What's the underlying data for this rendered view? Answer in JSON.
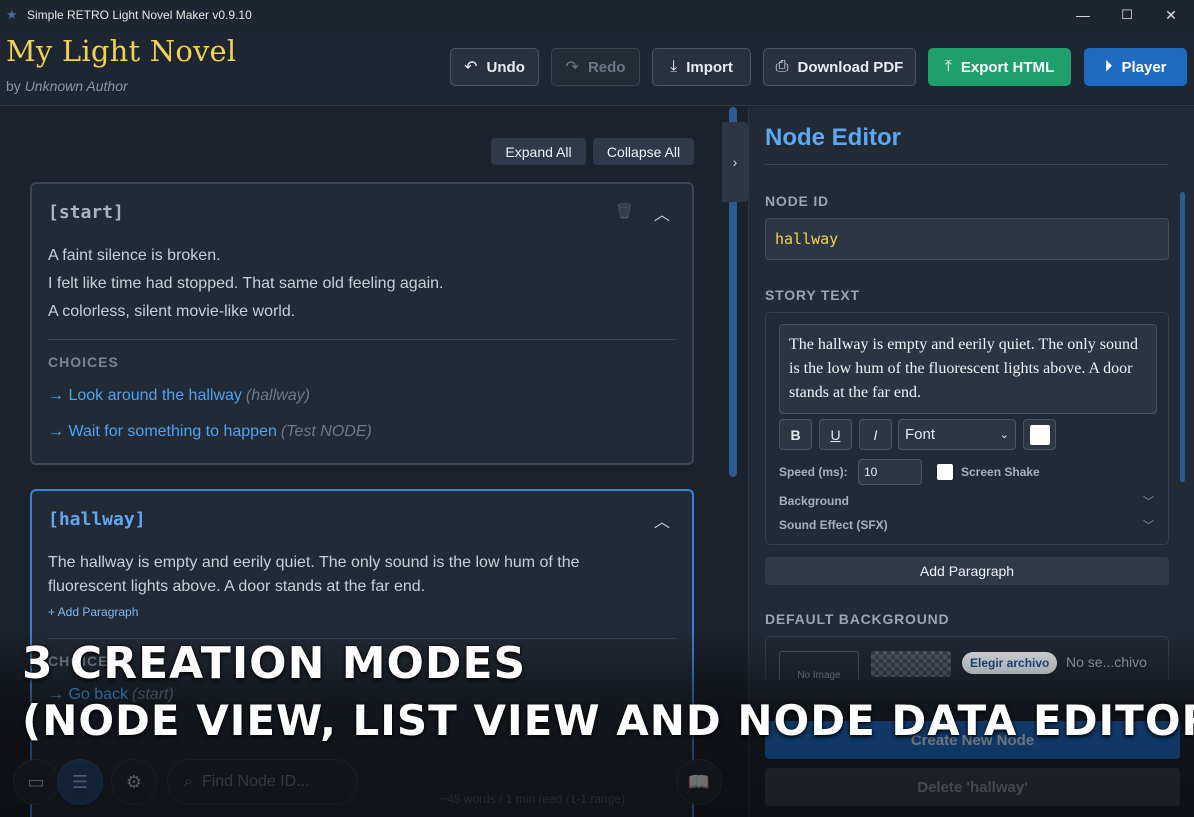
{
  "window": {
    "title": "Simple RETRO Light Novel Maker v0.9.10",
    "controls": [
      "—",
      "☐",
      "✕"
    ]
  },
  "header": {
    "app_title": "My Light Novel",
    "by": "by",
    "author": "Unknown Author",
    "buttons": {
      "undo": "Undo",
      "redo": "Redo",
      "import": "Import",
      "download_pdf": "Download PDF",
      "export_html": "Export HTML",
      "player": "Player"
    }
  },
  "list": {
    "expand_all": "Expand All",
    "collapse_all": "Collapse All",
    "cards": [
      {
        "id": "[start]",
        "lines": [
          "A faint silence is broken.",
          "I felt like time had stopped. That same old feeling again.",
          "A colorless, silent movie-like world."
        ],
        "choices_label": "CHOICES",
        "choices": [
          {
            "text": "→ Look around the hallway",
            "target": "(hallway)"
          },
          {
            "text": "→ Wait for something to happen",
            "target": "(Test NODE)"
          }
        ]
      },
      {
        "id": "[hallway]",
        "lines": [
          "The hallway is empty and eerily quiet. The only sound is the low hum of the",
          "fluorescent lights above. A door stands at the far end."
        ],
        "add_paragraph": "+ Add Paragraph",
        "choices_label": "CHOICES",
        "choices": [
          {
            "text": "→ Go back",
            "target": "(start)"
          }
        ]
      }
    ]
  },
  "dock": {
    "find_placeholder": "Find Node ID...",
    "word_count": "~45 words / 1 min read (1-1 range)"
  },
  "editor": {
    "title": "Node Editor",
    "node_id_label": "NODE ID",
    "node_id_value": "hallway",
    "story_text_label": "STORY TEXT",
    "story_text": "The hallway is empty and eerily quiet. The only sound is the low hum of the fluorescent lights above. A door stands at the far end.",
    "format": {
      "bold": "B",
      "underline": "U",
      "italic": "I",
      "font": "Font",
      "color": "#ffffff"
    },
    "speed_label": "Speed (ms):",
    "speed_value": "10",
    "screen_shake_label": "Screen Shake",
    "background_label": "Background",
    "sfx_label": "Sound Effect (SFX)",
    "add_paragraph": "Add Paragraph",
    "default_bg_label": "DEFAULT BACKGROUND",
    "no_image": "No Image",
    "choose_file": "Elegir archivo",
    "file_name": "No se...chivo",
    "create_node": "Create New Node",
    "delete_node": "Delete 'hallway'"
  },
  "caption": {
    "line1": "3 CREATION MODES",
    "line2": "(NODE VIEW, LIST VIEW AND NODE DATA EDITOR)"
  },
  "colors": {
    "accent": "#3b82d6",
    "title_gold": "#f3d24c",
    "export_green": "#1f9f6c",
    "player_blue": "#1f6bc4"
  }
}
